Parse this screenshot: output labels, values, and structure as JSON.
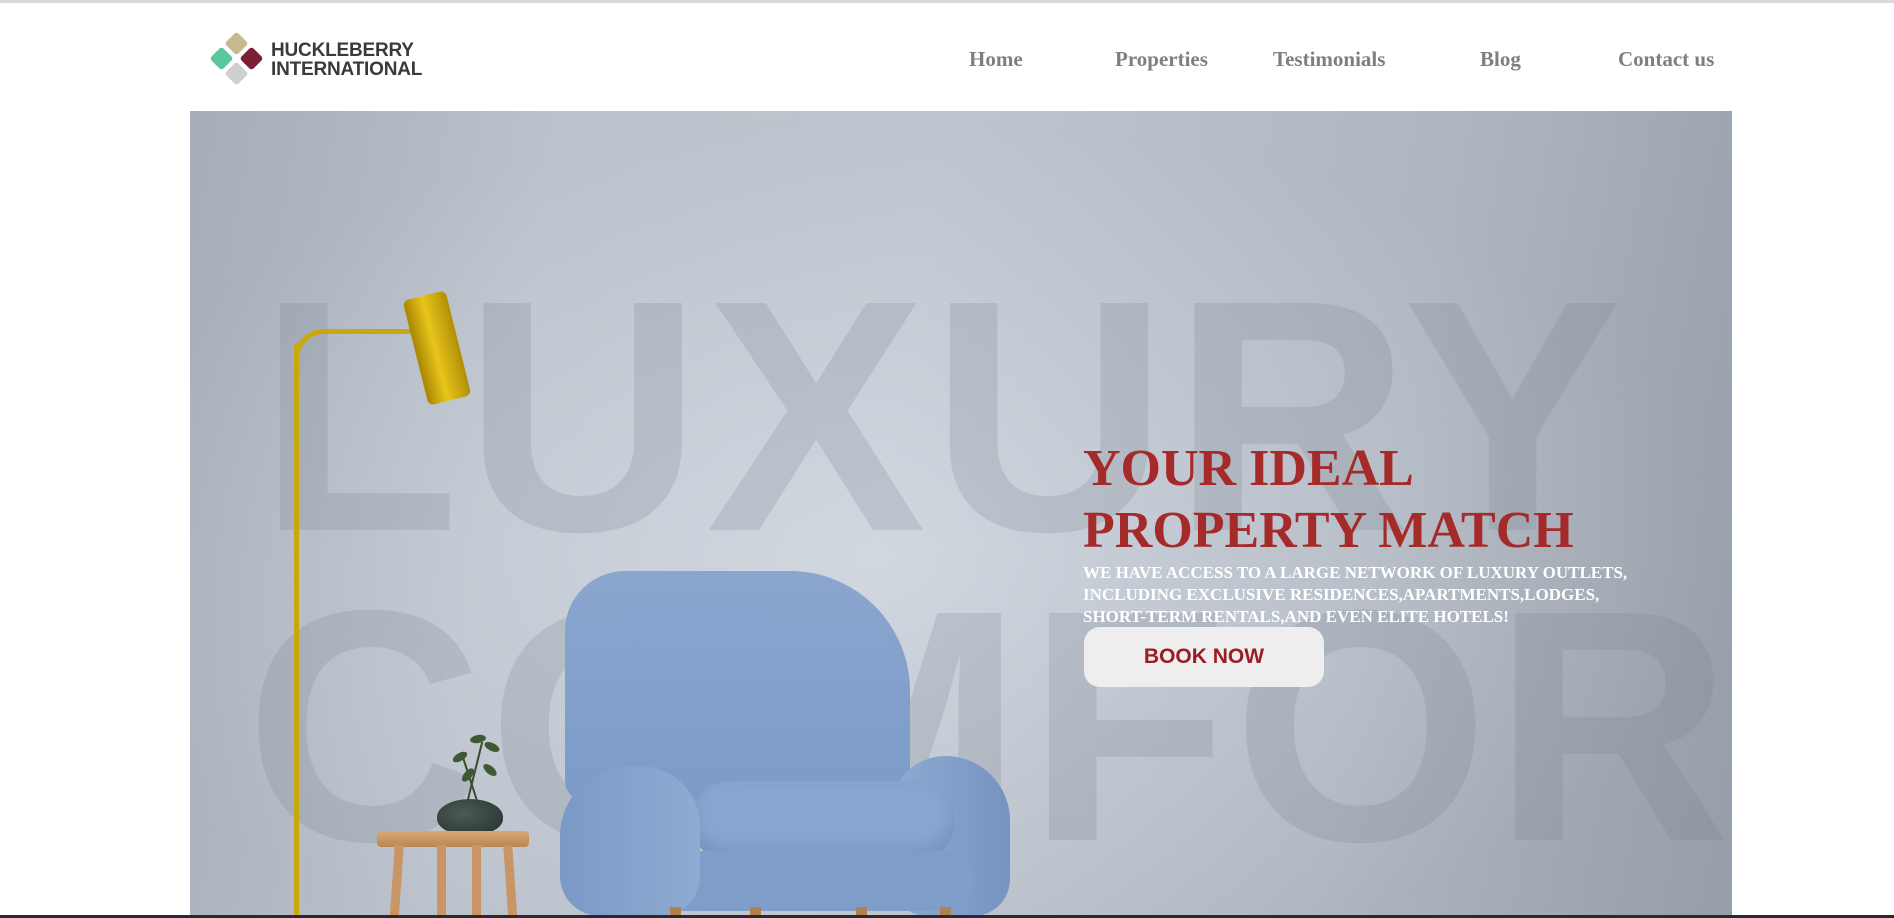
{
  "brand": {
    "name_line1": "HUCKLEBERRY",
    "name_line2": "INTERNATIONAL",
    "colors": {
      "top": "#c9b98f",
      "left": "#59c99d",
      "right": "#7a1f33",
      "bottom": "#cfcfd2"
    }
  },
  "nav": {
    "items": [
      {
        "label": "Home"
      },
      {
        "label": "Properties"
      },
      {
        "label": "Testimonials"
      },
      {
        "label": "Blog"
      },
      {
        "label": "Contact us"
      }
    ]
  },
  "hero": {
    "background_word_1": "LUXURY",
    "background_word_2": "COMFORT",
    "title_line1": "YOUR IDEAL",
    "title_line2": "PROPERTY MATCH",
    "subtitle_line1": "WE HAVE ACCESS TO A LARGE NETWORK OF LUXURY OUTLETS,",
    "subtitle_line2": "INCLUDING EXCLUSIVE RESIDENCES,APARTMENTS,LODGES,",
    "subtitle_line3": "SHORT-TERM RENTALS,AND EVEN ELITE HOTELS!",
    "cta_label": "BOOK NOW",
    "accent_color": "#a52a2a"
  }
}
